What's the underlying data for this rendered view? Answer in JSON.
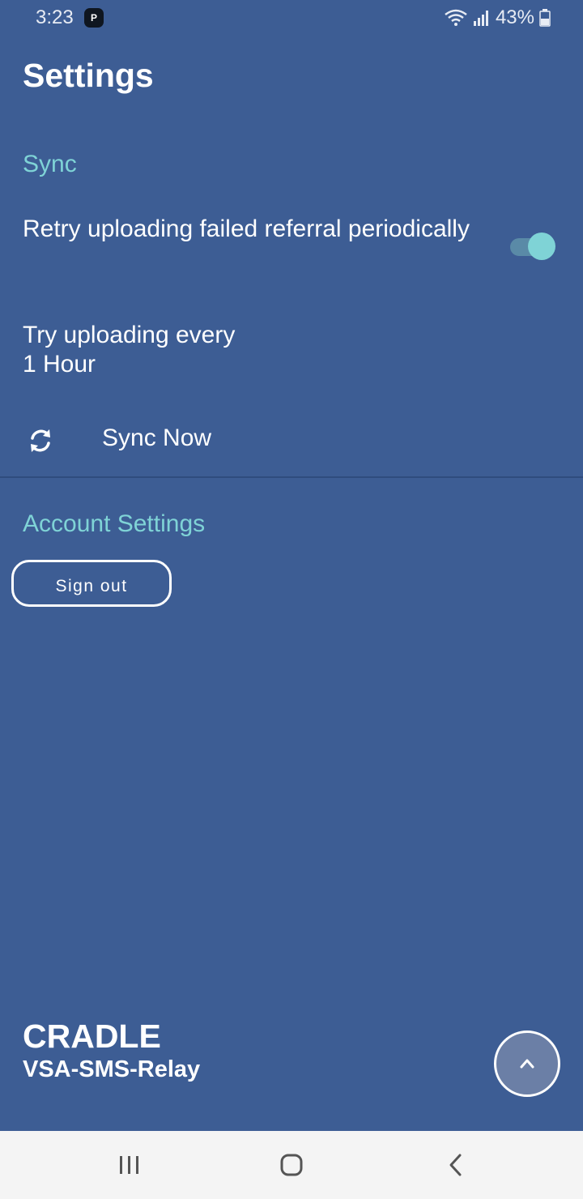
{
  "status_bar": {
    "time": "3:23",
    "app_icon": "P",
    "battery": "43%"
  },
  "page": {
    "title": "Settings"
  },
  "sync_section": {
    "header": "Sync",
    "retry_pref": {
      "title": "Retry uploading failed referral periodically",
      "enabled": true
    },
    "interval_pref": {
      "title": "Try uploading every",
      "summary": "1 Hour"
    },
    "sync_now_label": "Sync Now"
  },
  "account_section": {
    "header": "Account Settings",
    "sign_out_label": "Sign out"
  },
  "footer": {
    "brand": "CRADLE",
    "app_name": "VSA-SMS-Relay"
  },
  "colors": {
    "background": "#3d5d94",
    "accent": "#7fd3d6",
    "nav_bar": "#f4f4f4"
  },
  "icons": {
    "sync": "sync-icon",
    "scroll_up": "chevron-up-icon",
    "recents": "recents-icon",
    "home": "home-icon",
    "back": "back-icon"
  }
}
